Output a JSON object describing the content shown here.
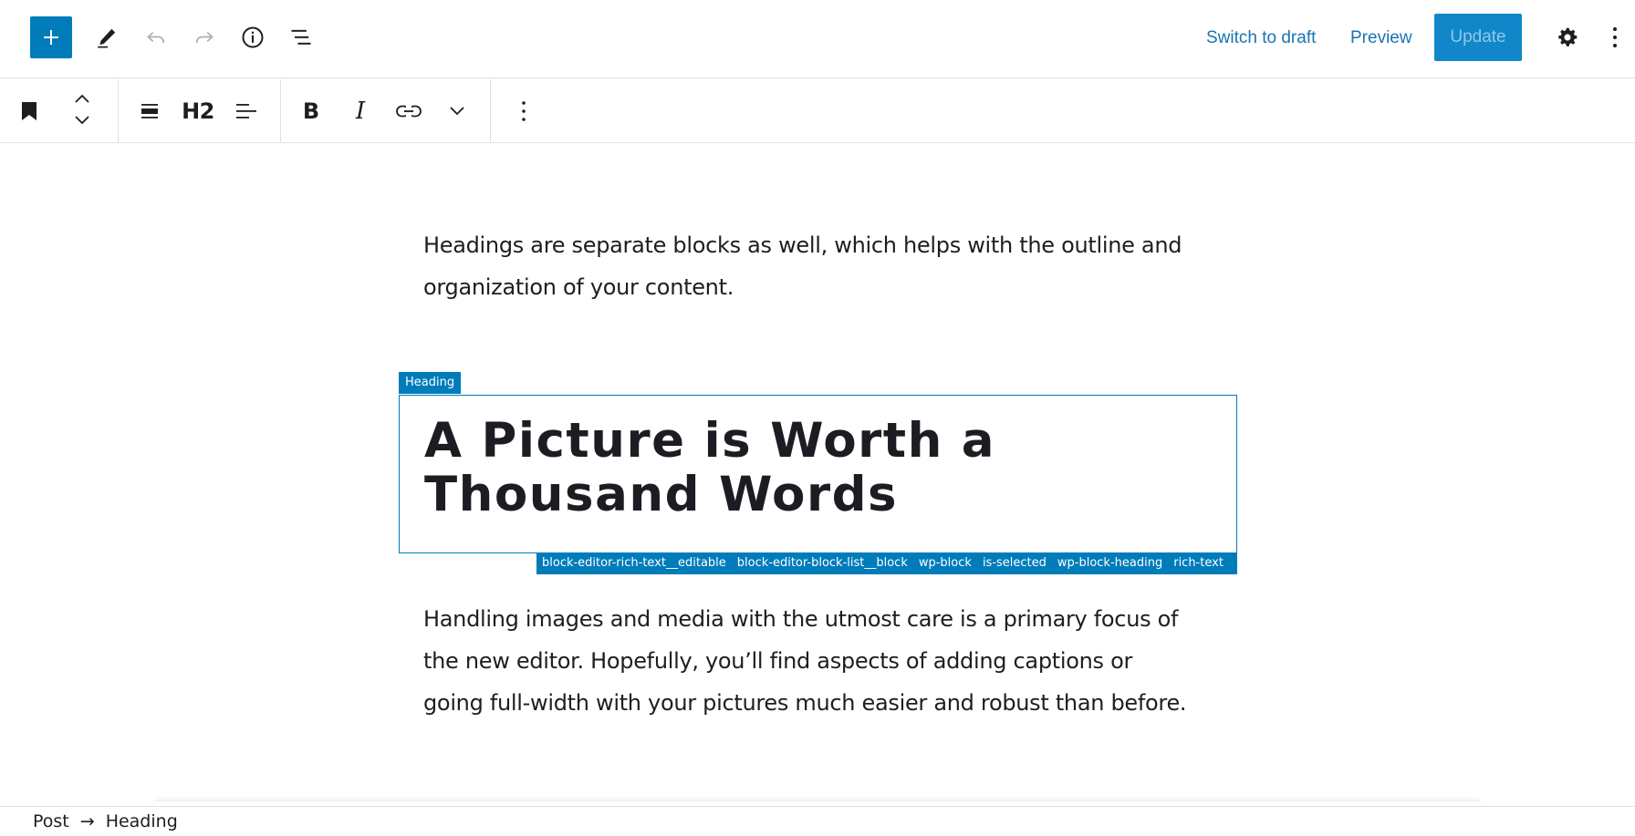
{
  "header": {
    "switch_to_draft": "Switch to draft",
    "preview": "Preview",
    "update": "Update"
  },
  "toolbar": {
    "heading_level": "H2",
    "bold": "B",
    "italic": "I"
  },
  "content": {
    "paragraph1": "Headings are separate blocks as well, which helps with the outline and organization of your content.",
    "block_label": "Heading",
    "heading": "A Picture is Worth a Thousand Words",
    "classes": [
      "block-editor-rich-text__editable",
      "block-editor-block-list__block",
      "wp-block",
      "is-selected",
      "wp-block-heading",
      "rich-text"
    ],
    "paragraph2": "Handling images and media with the utmost care is a primary focus of the new editor. Hopefully, you’ll find aspects of adding captions or going full-width with your pictures much easier and robust than before."
  },
  "breadcrumb": {
    "root": "Post",
    "separator": "→",
    "current": "Heading"
  },
  "colors": {
    "accent": "#007cba",
    "link": "#1874b2"
  },
  "icons": {
    "inserter": "plus-icon",
    "edit": "pencil-icon",
    "undo": "undo-icon",
    "redo": "redo-icon",
    "info": "info-icon",
    "outline": "list-view-icon",
    "settings": "gear-icon",
    "more": "more-vertical-icon"
  }
}
